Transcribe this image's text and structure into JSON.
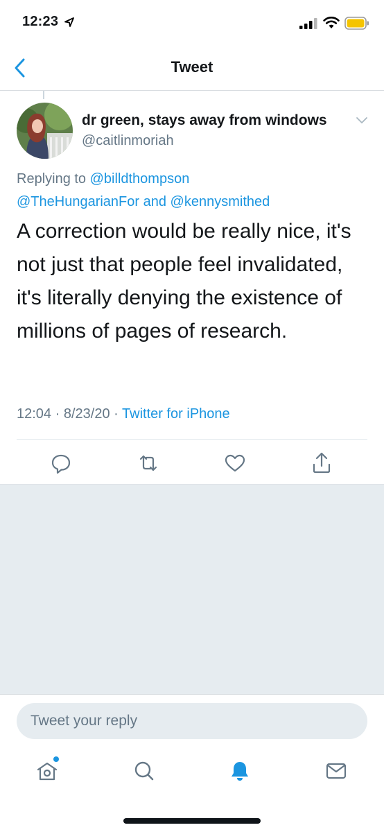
{
  "status_bar": {
    "time": "12:23",
    "icons": [
      "location-arrow-icon",
      "signal-icon",
      "wifi-icon",
      "battery-icon"
    ],
    "battery_color": "#f5c400"
  },
  "nav": {
    "back_icon": "chevron-left-icon",
    "title": "Tweet"
  },
  "tweet": {
    "display_name": "dr green, stays away from windows",
    "handle": "@caitlinmoriah",
    "replying_prefix": "Replying to ",
    "mention_1": "@billdthompson",
    "mention_2": "@TheHungarianFor",
    "mention_joiner": " and ",
    "mention_3": "@kennysmithed",
    "text": "A correction would be really nice, it's not just that people feel invalidated, it's literally denying the existence of millions of pages of research.",
    "time": "12:04",
    "date": "8/23/20",
    "separator": "·",
    "source": "Twitter for iPhone"
  },
  "actions": [
    "reply-icon",
    "retweet-icon",
    "like-icon",
    "share-icon"
  ],
  "reply_box": {
    "placeholder": "Tweet your reply"
  },
  "tab_bar": {
    "tabs": [
      "home-icon",
      "search-icon",
      "notifications-icon",
      "messages-icon"
    ],
    "active": "notifications-icon"
  },
  "colors": {
    "accent": "#1b95e0",
    "muted_text": "#657786",
    "background_gray": "#e6ecf0"
  }
}
